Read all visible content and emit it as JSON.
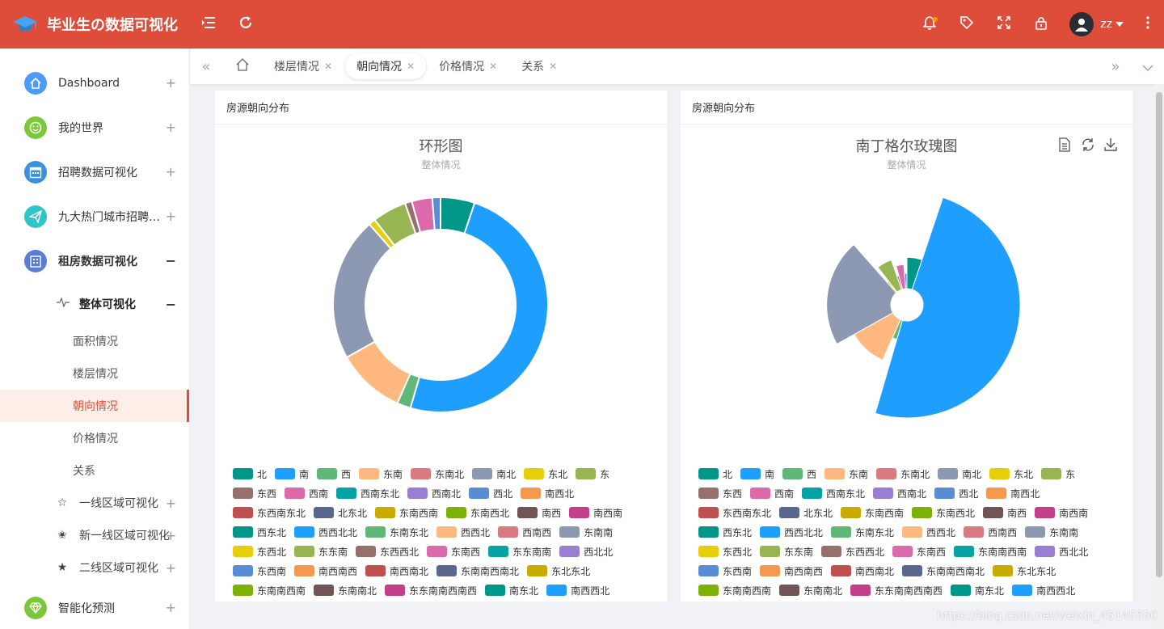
{
  "header": {
    "app_title": "毕业生の数据可视化",
    "user_name": "zz",
    "brand_color": "#de4d3a"
  },
  "sidebar": {
    "items": [
      {
        "label": "Dashboard",
        "color": "#4d9bf5",
        "icon": "home-icon"
      },
      {
        "label": "我的世界",
        "color": "#7bc93b",
        "icon": "smile-icon"
      },
      {
        "label": "招聘数据可视化",
        "color": "#3b8fe0",
        "icon": "calendar-icon"
      },
      {
        "label": "九大热门城市招聘数据",
        "color": "#2dc6c6",
        "icon": "paper-plane-icon"
      },
      {
        "label": "租房数据可视化",
        "color": "#5a7bd8",
        "icon": "building-icon"
      }
    ],
    "sub_head": "整体可视化",
    "leaves": [
      "面积情况",
      "楼层情况",
      "朝向情况",
      "价格情况",
      "关系"
    ],
    "sub_items": [
      "一线区域可视化",
      "新一线区域可视化",
      "二线区域可视化"
    ],
    "last_item": {
      "label": "智能化预测",
      "color": "#7bc93b",
      "icon": "diamond-icon"
    }
  },
  "tabs": [
    {
      "label": "楼层情况",
      "active": false
    },
    {
      "label": "朝向情况",
      "active": true
    },
    {
      "label": "价格情况",
      "active": false
    },
    {
      "label": "关系",
      "active": false
    }
  ],
  "panels": {
    "left_title": "房源朝向分布",
    "right_title": "房源朝向分布"
  },
  "watermark": "https://blog.csdn.net/weixin_45145550",
  "chart_data": [
    {
      "type": "pie",
      "variant": "donut",
      "title": "环形图",
      "subtitle": "整体情况",
      "categories": [
        "北",
        "南",
        "西",
        "东南",
        "东南北",
        "南北",
        "东北",
        "东",
        "东西",
        "西南",
        "西南东北",
        "西南北",
        "西北",
        "南西北",
        "东西南东北",
        "北东北",
        "东南西南",
        "东南西北",
        "南西",
        "南西南",
        "西东北",
        "西西北北",
        "东南东北",
        "西西北",
        "西南西",
        "东南南",
        "东西北",
        "东东南",
        "东西西北",
        "东南西",
        "东东南南",
        "西北北",
        "东西南",
        "南西南西",
        "南西南北",
        "东南南西南北",
        "东北东北",
        "东南南西南",
        "东南南北",
        "东东南南西南西",
        "南东北",
        "南西西北"
      ],
      "values": [
        5,
        48,
        2,
        10,
        0,
        21,
        1,
        5,
        1,
        3,
        0,
        0,
        1.2,
        0,
        0,
        0,
        0,
        0,
        0,
        0,
        0,
        0,
        0,
        0,
        0,
        0,
        0,
        0,
        0,
        0,
        0,
        0,
        0,
        0,
        0,
        0,
        0,
        0,
        0,
        0,
        0,
        0
      ]
    },
    {
      "type": "pie",
      "variant": "nightingale-rose",
      "title": "南丁格尔玫瑰图",
      "subtitle": "整体情况",
      "categories": [
        "北",
        "南",
        "西",
        "东南",
        "东南北",
        "南北",
        "东北",
        "东",
        "东西",
        "西南",
        "西南东北",
        "西南北",
        "西北",
        "南西北",
        "东西南东北",
        "北东北",
        "东南西南",
        "东南西北",
        "南西",
        "南西南",
        "西东北",
        "西西北北",
        "东南东北",
        "西西北",
        "西南西",
        "东南南",
        "东西北",
        "东东南",
        "东西西北",
        "东南西",
        "东南南西南",
        "西北北",
        "东西南",
        "南西南西",
        "南西南北",
        "东南南西南北",
        "东北东北",
        "东南南西南",
        "东南南北",
        "东东南南西南西",
        "南东北",
        "南西西北"
      ],
      "values": [
        5,
        48,
        2,
        10,
        0,
        21,
        1,
        5,
        1,
        3,
        0,
        0,
        1.2,
        0,
        0,
        0,
        0,
        0,
        0,
        0,
        0,
        0,
        0,
        0,
        0,
        0,
        0,
        0,
        0,
        0,
        0,
        0,
        0,
        0,
        0,
        0,
        0,
        0,
        0,
        0,
        0,
        0
      ]
    }
  ],
  "legend_colors": [
    "#009688",
    "#1e9fff",
    "#5fb878",
    "#ffb980",
    "#d87a80",
    "#8d98b3",
    "#e5cf0d",
    "#97b552",
    "#95706d",
    "#dc69aa",
    "#07a2a4",
    "#9a7fd1",
    "#588dd5",
    "#f5994e",
    "#c05050",
    "#59678c",
    "#c9ab00",
    "#7eb00a",
    "#6f5553",
    "#c14089",
    "#009688",
    "#1e9fff",
    "#5fb878",
    "#ffb980",
    "#d87a80",
    "#8d98b3",
    "#e5cf0d",
    "#97b552",
    "#95706d",
    "#dc69aa",
    "#07a2a4",
    "#9a7fd1",
    "#588dd5",
    "#f5994e",
    "#c05050",
    "#59678c",
    "#c9ab00",
    "#7eb00a",
    "#6f5553",
    "#c14089",
    "#009688",
    "#1e9fff"
  ]
}
